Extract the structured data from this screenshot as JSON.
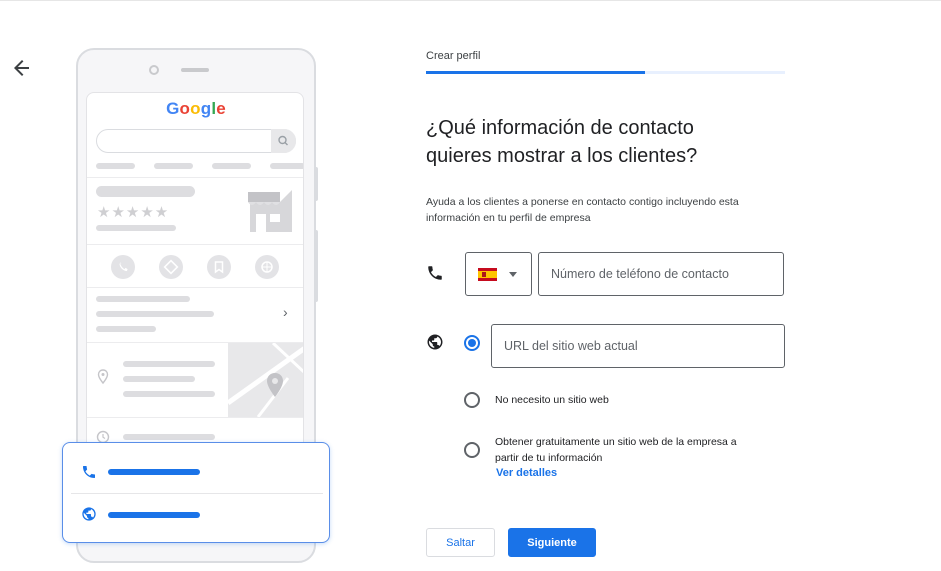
{
  "header": {
    "step_label": "Crear perfil",
    "progress_fraction": 0.61
  },
  "illustration": {
    "logo_text": "Google",
    "stars": "★★★★★"
  },
  "form": {
    "heading_line1": "¿Qué información de contacto",
    "heading_line2": "quieres mostrar a los clientes?",
    "description": "Ayuda a los clientes a ponerse en contacto contigo incluyendo esta información en tu perfil de empresa",
    "phone": {
      "country_flag": "ES",
      "placeholder": "Número de teléfono de contacto",
      "value": ""
    },
    "website": {
      "placeholder": "URL del sitio web actual",
      "value": "",
      "options": [
        {
          "label": "No necesito un sitio web",
          "selected": false
        },
        {
          "label_line1": "Obtener gratuitamente un sitio web de la empresa a",
          "label_line2": "partir de tu información",
          "link": "Ver detalles",
          "selected": false
        }
      ]
    }
  },
  "buttons": {
    "skip": "Saltar",
    "next": "Siguiente"
  },
  "colors": {
    "accent": "#1a73e8",
    "text": "#202124",
    "border": "#5f6368"
  }
}
